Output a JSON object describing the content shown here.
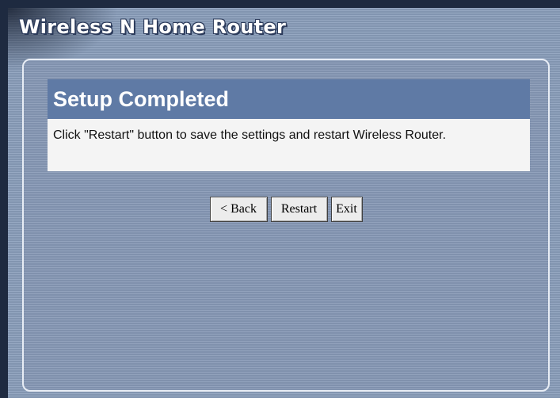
{
  "app": {
    "title": "Wireless N Home Router"
  },
  "section": {
    "title": "Setup Completed",
    "message": "Click \"Restart\" button to save the settings and restart Wireless Router."
  },
  "buttons": {
    "back_label": "< Back",
    "restart_label": "Restart",
    "exit_label": "Exit"
  },
  "colors": {
    "header_bar": "#5f7aa5",
    "background": "#8a9ebb",
    "message_bg": "#f4f4f4"
  }
}
